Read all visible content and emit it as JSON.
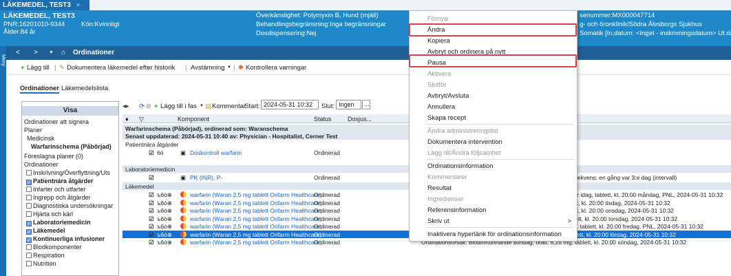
{
  "tab": {
    "label": "LÄKEMEDEL, TEST3",
    "close": "×"
  },
  "banner": {
    "name": "LÄKEMEDEL, TEST3",
    "pnr": "PNR:16201010-9344",
    "gender": "Kön:Kvinnligt",
    "age": "Ålder:84 år",
    "allergy": "Överkänslighet: Polymyxin B, Hund (mjäll)",
    "limit": "Behandlingsbegränsning:Inga begränsningar",
    "dispense": "Dosdispensering:Nej",
    "right1": "senummer:MX000047714",
    "right2": "g- och öronklinik/Södra Älvsborgs Sjukhus",
    "right3": "Somatik [In.datum: <Inget - inskrivningsdatum> Ut.da"
  },
  "sidebar": {
    "label": "Meny"
  },
  "nav": {
    "back": "<",
    "fwd": ">",
    "title": "Ordinationer"
  },
  "toolbar": {
    "add": "Lägg till",
    "document": "Dokumentera läkemedel efter historik",
    "reconcile": "Avstämning",
    "check": "Kontrollera varningar"
  },
  "subtabs": [
    "Ordinationer",
    "Läkemedelslista"
  ],
  "leftpane": {
    "header": "Visa",
    "items": [
      {
        "label": "Ordinationer att signera",
        "type": "text",
        "bold": false,
        "indent": 0
      },
      {
        "label": "Planer",
        "type": "text",
        "bold": false,
        "indent": 0
      },
      {
        "label": "Medicinsk",
        "type": "text",
        "bold": false,
        "indent": 4
      },
      {
        "label": "Warfarinschema (Påbörjad)",
        "type": "text",
        "bold": true,
        "indent": 10
      },
      {
        "label": "Föreslagna planer (0)",
        "type": "text",
        "bold": false,
        "indent": 0
      },
      {
        "label": "Ordinationer",
        "type": "text",
        "bold": false,
        "indent": 0
      },
      {
        "label": "Inskrivning/Överflyttning/Uts",
        "type": "cb",
        "checked": false,
        "bold": false
      },
      {
        "label": "Patientnära åtgärder",
        "type": "cb",
        "checked": true,
        "bold": true
      },
      {
        "label": "Infarter och utfarter",
        "type": "cb",
        "checked": false,
        "bold": false
      },
      {
        "label": "Ingrepp och åtgärder",
        "type": "cb",
        "checked": false,
        "bold": false
      },
      {
        "label": "Diagnostiska undersökningar",
        "type": "cb",
        "checked": false,
        "bold": false
      },
      {
        "label": "Hjärta och kärl",
        "type": "cb",
        "checked": false,
        "bold": false
      },
      {
        "label": "Laboratoriemedicin",
        "type": "cb",
        "checked": true,
        "bold": true
      },
      {
        "label": "Läkemedel",
        "type": "cb",
        "checked": true,
        "bold": true
      },
      {
        "label": "Kontinuerliga infusioner",
        "type": "cb",
        "checked": true,
        "bold": true
      },
      {
        "label": "Blodkomponenter",
        "type": "cb",
        "checked": false,
        "bold": false
      },
      {
        "label": "Respiration",
        "type": "cb",
        "checked": false,
        "bold": false
      },
      {
        "label": "Nutrition",
        "type": "cb",
        "checked": false,
        "bold": false
      }
    ]
  },
  "gridtoolbar": {
    "addphase": "Lägg till i fas",
    "comment": "Kommentar",
    "start_label": "Start:",
    "start_value": "2024-05-31 10:32",
    "end_label": "Slut:",
    "end_value": "Ingen",
    "more": "..."
  },
  "columns": [
    "Komponent",
    "Status",
    "Dosjus..."
  ],
  "grid": {
    "plan_title": "Warfarinschema (Påbörjad), ordinerad som: Waranschema",
    "plan_updated": "Senast uppdaterad: 2024-05-31 10:40   av: Physician - Hospitalist, Cerner Test",
    "sec_patient": "Patientnära åtgärder",
    "dose_control": "Doskontroll warfarin",
    "sec_lab": "Laboratoriemedicin",
    "pk": "PK (INR), P-",
    "sec_drug": "Läkemedel",
    "status": "Ordinerad",
    "drug": "warfarin (Waran 2,5 mg tablett Orifarm Healthcare)",
    "note_pat": "are.",
    "note_lab": "i, Frekvens: en gång var 3:e dag (intervall)",
    "details": [
      "etter idag, tablett, kl. 20:00 måndag, PNL, 2024-05-31 10:32",
      "blett, kl. 20:00 tisdag, 2024-05-31 10:32",
      "blett, kl. 20:00 onsdag, 2024-05-31 10:32",
      "ablett, kl. 20:00 torsdag, 2024-05-31 10:32",
      "tabl, tablett, kl. 20:00 fredag, PNL, 2024-05-31 10:32",
      "tablett, kl. 20:00 lördag, 2024-05-31 10:32",
      "Ordinationsorsak: Blodförtunnande söndag, oralt, 6,25 mg, tablett, kl. 20:00 söndag, 2024-05-31 10:32"
    ]
  },
  "menu": {
    "items": [
      {
        "label": "Förnya",
        "disabled": true
      },
      {
        "label": "Ändra",
        "disabled": false
      },
      {
        "label": "Kopiera",
        "disabled": false
      },
      {
        "label": "Avbryt och ordinera på nytt",
        "disabled": false
      },
      {
        "label": "Pausa",
        "disabled": false
      },
      {
        "label": "Aktivera",
        "disabled": true
      },
      {
        "label": "Slutför",
        "disabled": true
      },
      {
        "label": "Avbryt/Avsluta",
        "disabled": false
      },
      {
        "label": "Annullera",
        "disabled": false
      },
      {
        "label": "Skapa recept",
        "disabled": false
      },
      {
        "label": "Ändra administreringstid",
        "disabled": true
      },
      {
        "label": "Dokumentera intervention",
        "disabled": false
      },
      {
        "label": "Lägg till/Ändra följsamhet",
        "disabled": true
      },
      {
        "label": "Ordinationsinformation",
        "disabled": false
      },
      {
        "label": "Kommentarer",
        "disabled": true
      },
      {
        "label": "Resultat",
        "disabled": false
      },
      {
        "label": "Ingredienser",
        "disabled": true
      },
      {
        "label": "Referensinformation",
        "disabled": false
      },
      {
        "label": "Skriv ut",
        "disabled": false,
        "submenu": ">"
      },
      {
        "label": "Inaktivera hyperlänk för ordinationsinformation",
        "disabled": false
      }
    ]
  }
}
